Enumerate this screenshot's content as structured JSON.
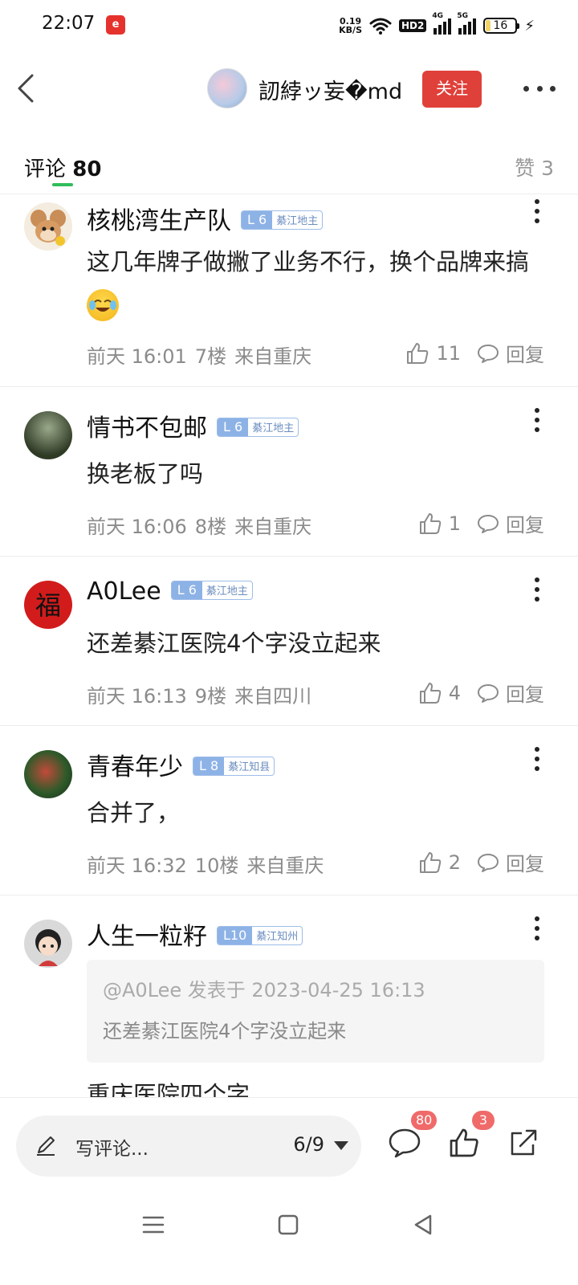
{
  "status": {
    "time": "22:07",
    "app_icon_text": "e",
    "net_speed_value": "0.19",
    "net_speed_unit": "KB/S",
    "hd_label": "HD2",
    "signal1_label": "4G",
    "signal2_label": "5G",
    "battery": "16"
  },
  "nav": {
    "author_name": "訒綍ッ妄�md",
    "follow_label": "关注"
  },
  "tabs": {
    "comments_label": "评论",
    "comments_count": "80",
    "likes_label": "赞 3"
  },
  "comments": [
    {
      "user": "核桃湾生产队",
      "level": "L 6",
      "title": "綦江地主",
      "text": "这几年牌子做撇了业务不行，换个品牌来搞",
      "time": "前天 16:01",
      "floor": "7楼",
      "location": "来自重庆",
      "likes": "11",
      "reply_label": "回复"
    },
    {
      "user": "情书不包邮",
      "level": "L 6",
      "title": "綦江地主",
      "text": "换老板了吗",
      "time": "前天 16:06",
      "floor": "8楼",
      "location": "来自重庆",
      "likes": "1",
      "reply_label": "回复"
    },
    {
      "user": "A0Lee",
      "level": "L 6",
      "title": "綦江地主",
      "text": "还差綦江医院4个字没立起来",
      "time": "前天 16:13",
      "floor": "9楼",
      "location": "来自四川",
      "likes": "4",
      "reply_label": "回复"
    },
    {
      "user": "青春年少",
      "level": "L 8",
      "title": "綦江知县",
      "text": "合并了，",
      "time": "前天 16:32",
      "floor": "10楼",
      "location": "来自重庆",
      "likes": "2",
      "reply_label": "回复"
    },
    {
      "user": "人生一粒籽",
      "level": "L10",
      "title": "綦江知州",
      "quote_head": "@A0Lee 发表于 2023-04-25 16:13",
      "quote_body": "还差綦江医院4个字没立起来",
      "text": "重庆医院四个字"
    }
  ],
  "bottom": {
    "write_label": "写评论...",
    "page_indicator": "6/9",
    "comment_count": "80",
    "like_count": "3"
  },
  "colors": {
    "accent_red": "#e0403a",
    "tab_green": "#2fbd5a",
    "badge_blue": "#8db2e6"
  }
}
